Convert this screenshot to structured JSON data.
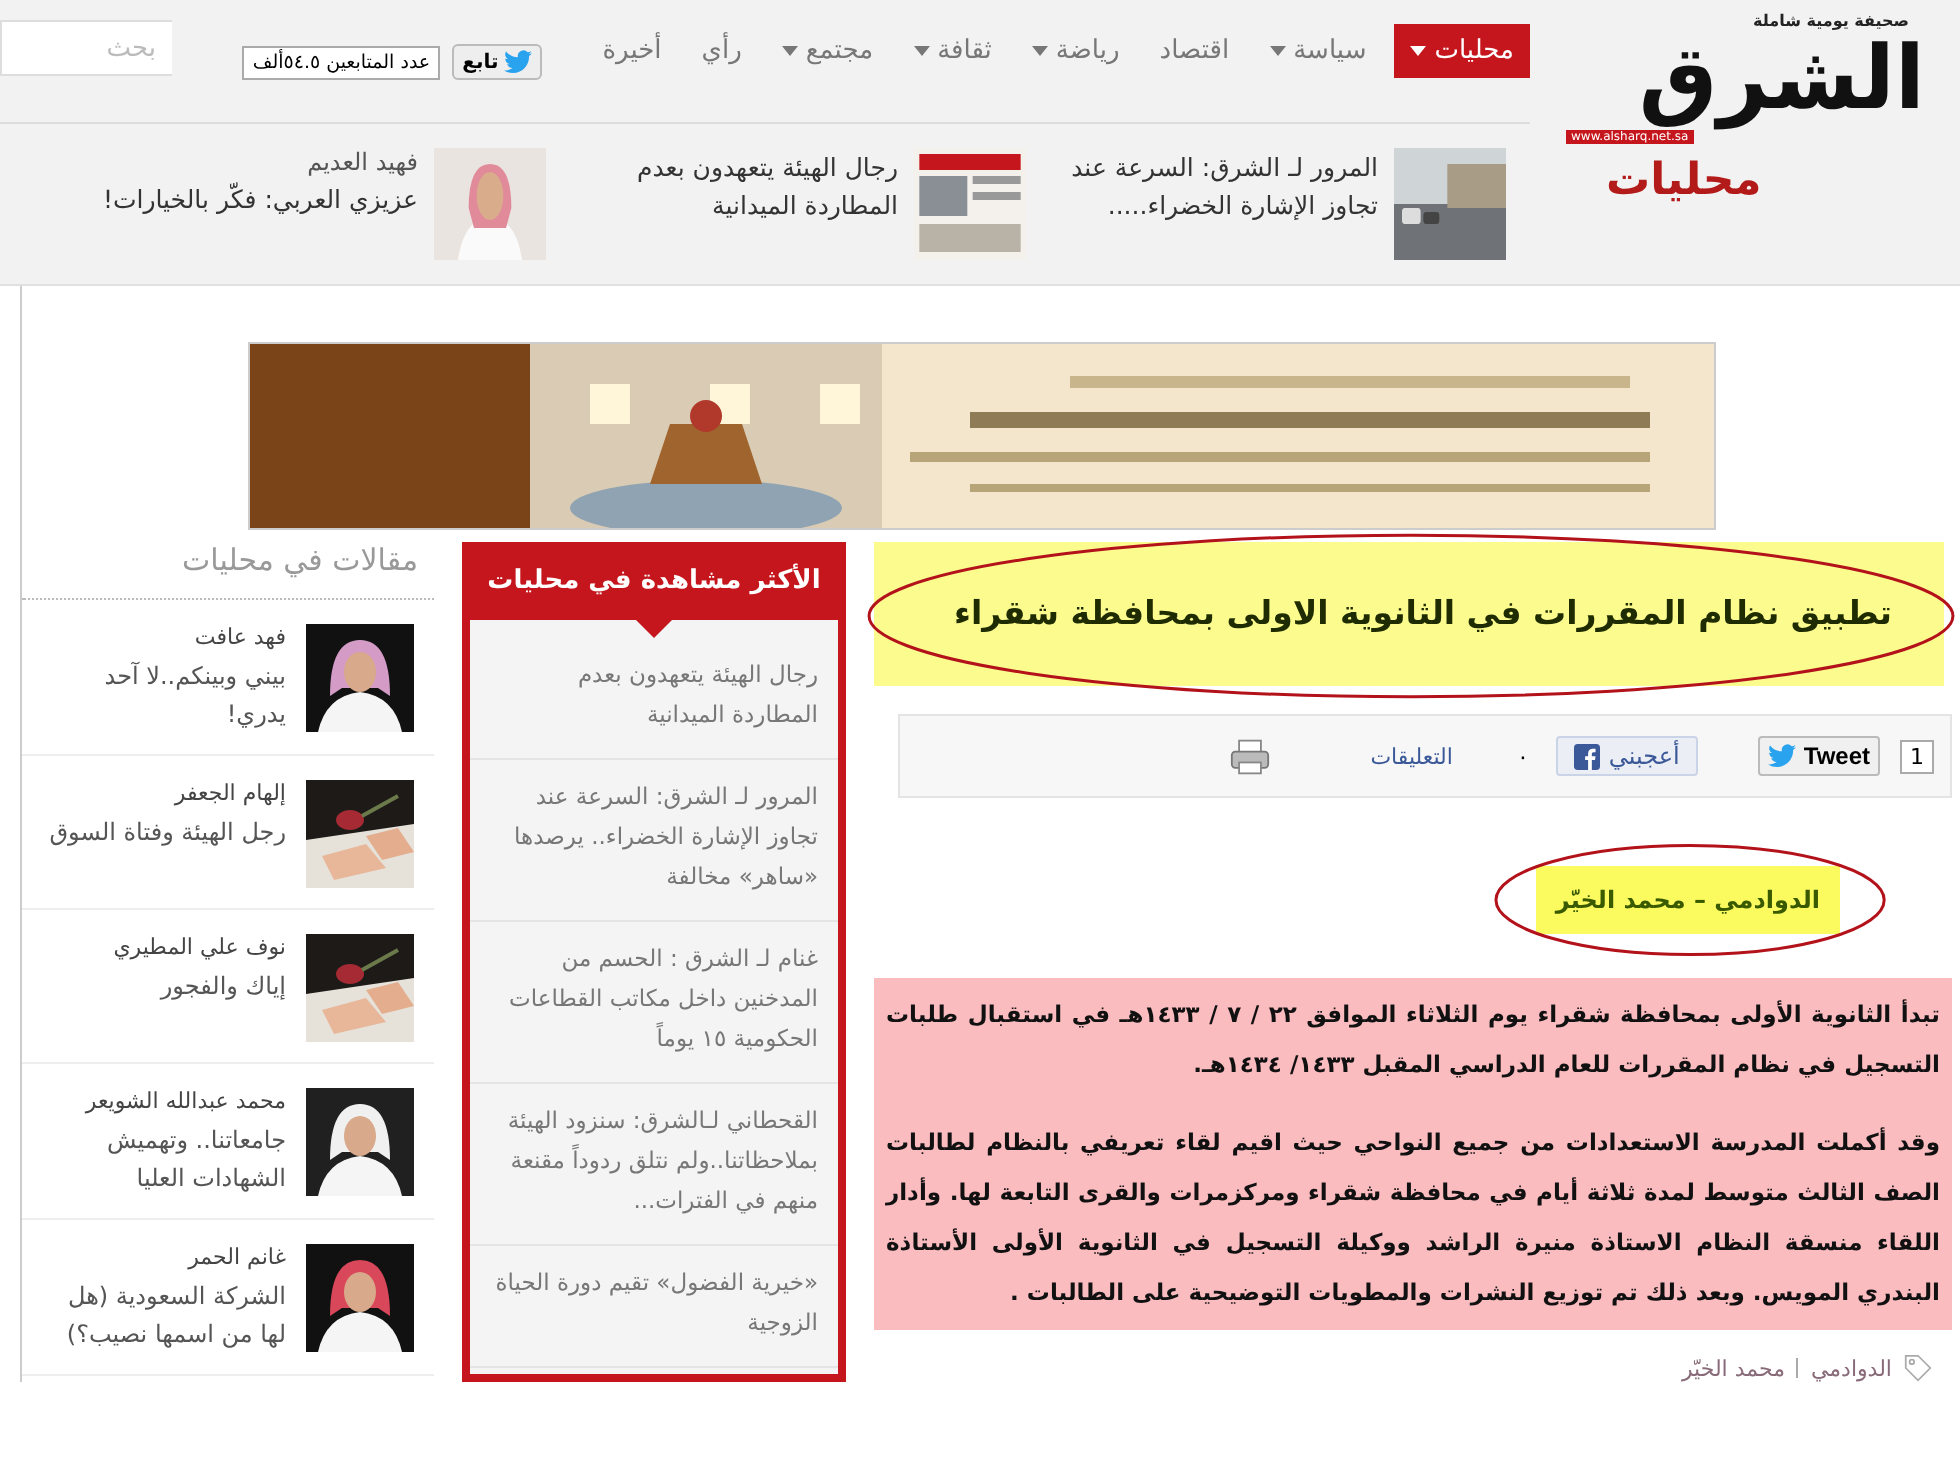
{
  "logo": {
    "name": "الشرق",
    "tagline": "صحيفة يومية شاملة",
    "url": "www.alsharq.net.sa"
  },
  "nav": [
    {
      "label": "محليات",
      "selected": true,
      "dropdown": true
    },
    {
      "label": "سياسة",
      "selected": false,
      "dropdown": true
    },
    {
      "label": "اقتصاد",
      "selected": false,
      "dropdown": false
    },
    {
      "label": "رياضة",
      "selected": false,
      "dropdown": true
    },
    {
      "label": "ثقافة",
      "selected": false,
      "dropdown": true
    },
    {
      "label": "مجتمع",
      "selected": false,
      "dropdown": true
    },
    {
      "label": "رأي",
      "selected": false,
      "dropdown": false
    },
    {
      "label": "أخيرة",
      "selected": false,
      "dropdown": false
    }
  ],
  "follow": {
    "button": "تابع",
    "count": "عدد المتابعين ٥٤.٥ألف"
  },
  "search": {
    "placeholder": "بحث"
  },
  "section_title": "محليات",
  "top_stories": [
    {
      "title": "المرور لـ الشرق: السرعة عند تجاوز الإشارة الخضراء....."
    },
    {
      "title": "رجال الهيئة يتعهدون بعدم المطاردة الميدانية"
    },
    {
      "author": "فهيد العديم",
      "title": "عزيزي العربي: فكّر بالخيارات!"
    }
  ],
  "article": {
    "title": "تطبيق نظام المقررات في الثانوية الاولى بمحافظة شقراء",
    "share": {
      "tweet_count": "1",
      "tweet": "Tweet",
      "like": "أعجبني",
      "like_count": "٠",
      "comments": "التعليقات"
    },
    "byline": "الدوادمي – محمد الخيّر",
    "paragraphs": [
      "تبدأ الثانوية الأولى بمحافظة شقراء يوم الثلاثاء الموافق ٢٢ / ٧ / ١٤٣٣هـ في استقبال طلبات التسجيل في نظام المقررات للعام الدراسي المقبل ١٤٣٣/ ١٤٣٤هـ.",
      "وقد أكملت المدرسة الاستعدادات من جميع النواحي حيث اقيم لقاء تعريفي بالنظام لطالبات الصف الثالث متوسط لمدة ثلاثة أيام في محافظة شقراء ومركزمرات والقرى التابعة لها. وأدار اللقاء منسقة النظام الاستاذة منيرة الراشد ووكيلة التسجيل في الثانوية الأولى الأستاذة البندري المويس. وبعد ذلك تم توزيع النشرات والمطويات التوضيحية على الطالبات ."
    ],
    "tags": [
      "الدوادمي",
      "محمد الخيّر"
    ]
  },
  "most_viewed": {
    "title": "الأكثر مشاهدة في محليات",
    "items": [
      "رجال الهيئة يتعهدون بعدم المطاردة الميدانية",
      "المرور لـ الشرق: السرعة عند تجاوز الإشارة الخضراء.. يرصدها «ساهر» مخالفة",
      "غنام لـ الشرق : الحسم من المدخنين داخل مكاتب القطاعات الحكومية ١٥ يوماً",
      "القحطاني لـالشرق: سنزود الهيئة بملاحظاتنا..ولم نتلق ردوداً مقنعة منهم في الفترات...",
      "«خيرية الفضول» تقيم دورة الحياة الزوجية"
    ]
  },
  "columns": {
    "title": "مقالات في محليات",
    "items": [
      {
        "author": "فهد عافت",
        "title": "بيني وبينكم..لا آحد يدري!"
      },
      {
        "author": "إلهام الجعفر",
        "title": "رجل الهيئة وفتاة السوق"
      },
      {
        "author": "نوف علي المطيري",
        "title": "إياك والفجور"
      },
      {
        "author": "محمد عبدالله الشويعر",
        "title": "جامعاتنا.. وتهميش الشهادات العليا"
      },
      {
        "author": "غانم الحمر",
        "title": "الشركة السعودية (هل لها من اسمها نصيب؟)"
      }
    ]
  }
}
